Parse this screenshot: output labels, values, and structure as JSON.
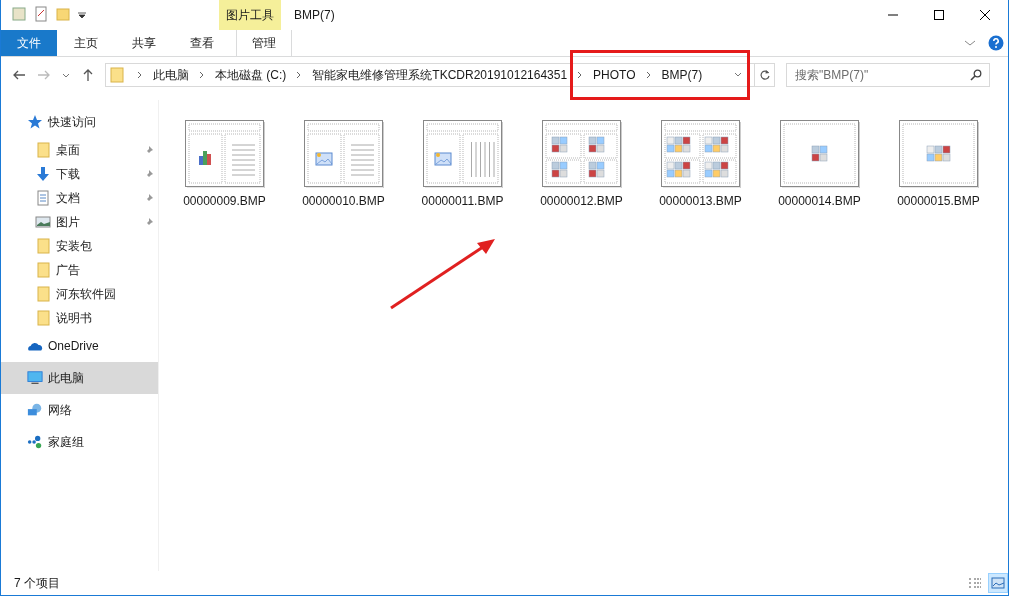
{
  "window": {
    "title": "BMP(7)",
    "contextual_group": "图片工具"
  },
  "ribbon_tabs": [
    {
      "label": "文件",
      "kind": "file"
    },
    {
      "label": "主页",
      "kind": "tab"
    },
    {
      "label": "共享",
      "kind": "tab"
    },
    {
      "label": "查看",
      "kind": "tab"
    },
    {
      "label": "管理",
      "kind": "contextual"
    }
  ],
  "address_bar": {
    "crumbs": [
      "此电脑",
      "本地磁盘 (C:)",
      "智能家电维修管理系统TKCDR20191012164351",
      "PHOTO",
      "BMP(7)"
    ]
  },
  "search": {
    "placeholder": "搜索\"BMP(7)\""
  },
  "sidebar": [
    {
      "label": "快速访问",
      "selected": false,
      "children": [
        {
          "label": "桌面",
          "pinned": true,
          "selected": false
        },
        {
          "label": "下载",
          "pinned": true,
          "selected": false
        },
        {
          "label": "文档",
          "pinned": true,
          "selected": false
        },
        {
          "label": "图片",
          "pinned": true,
          "selected": false
        },
        {
          "label": "安装包",
          "pinned": false,
          "selected": false
        },
        {
          "label": "广告",
          "pinned": false,
          "selected": false
        },
        {
          "label": "河东软件园",
          "pinned": false,
          "selected": false
        },
        {
          "label": "说明书",
          "pinned": false,
          "selected": false
        }
      ]
    },
    {
      "label": "OneDrive",
      "selected": false
    },
    {
      "label": "此电脑",
      "selected": true
    },
    {
      "label": "网络",
      "selected": false
    },
    {
      "label": "家庭组",
      "selected": false
    }
  ],
  "files": [
    {
      "name": "00000009.BMP",
      "kind": "chart-list"
    },
    {
      "name": "00000010.BMP",
      "kind": "picture-list"
    },
    {
      "name": "00000011.BMP",
      "kind": "picture-columns"
    },
    {
      "name": "00000012.BMP",
      "kind": "grid-four"
    },
    {
      "name": "00000013.BMP",
      "kind": "grid-six"
    },
    {
      "name": "00000014.BMP",
      "kind": "single-four"
    },
    {
      "name": "00000015.BMP",
      "kind": "single-six"
    }
  ],
  "status_bar": {
    "item_count": "7 个项目"
  },
  "view_buttons": [
    {
      "kind": "details",
      "selected": false
    },
    {
      "kind": "large-icons",
      "selected": true
    }
  ],
  "annotations": {
    "highlight_box": true,
    "arrow": true
  }
}
